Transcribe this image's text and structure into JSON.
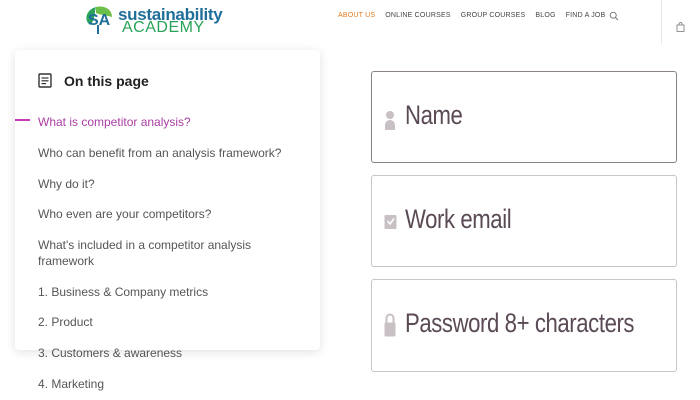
{
  "header": {
    "logo": {
      "line1": "sustainability",
      "line2": "ACADEMY",
      "icon": "leaf-sa-logo"
    },
    "nav": [
      {
        "label": "ABOUT US",
        "active": true
      },
      {
        "label": "ONLINE COURSES",
        "active": false
      },
      {
        "label": "GROUP COURSES",
        "active": false
      },
      {
        "label": "BLOG",
        "active": false
      },
      {
        "label": "FIND A JOB",
        "active": false
      }
    ],
    "icons": [
      "search-icon",
      "shopping-bag-icon"
    ],
    "colors": {
      "active_nav": "#e07a1f",
      "logo_blue": "#1f6f9a",
      "logo_green": "#29a35a"
    }
  },
  "toc": {
    "heading": "On this page",
    "heading_icon": "document-icon",
    "items": [
      {
        "label": "What is competitor analysis?",
        "active": true
      },
      {
        "label": "Who can benefit from an analysis framework?",
        "active": false
      },
      {
        "label": "Why do it?",
        "active": false
      },
      {
        "label": "Who even are your competitors?",
        "active": false
      },
      {
        "label": "What's included in a competitor analysis framework",
        "active": false
      },
      {
        "label": "1. Business & Company metrics",
        "active": false
      },
      {
        "label": "2. Product",
        "active": false
      },
      {
        "label": "3. Customers & awareness",
        "active": false
      },
      {
        "label": "4. Marketing",
        "active": false
      }
    ],
    "colors": {
      "active": "#a93ea4",
      "marker": "#c93bb6"
    }
  },
  "form": {
    "fields": [
      {
        "placeholder": "Name",
        "icon": "person-icon"
      },
      {
        "placeholder": "Work email",
        "icon": "checkbox-icon"
      },
      {
        "placeholder": "Password 8+ characters",
        "icon": "lock-icon"
      }
    ]
  }
}
